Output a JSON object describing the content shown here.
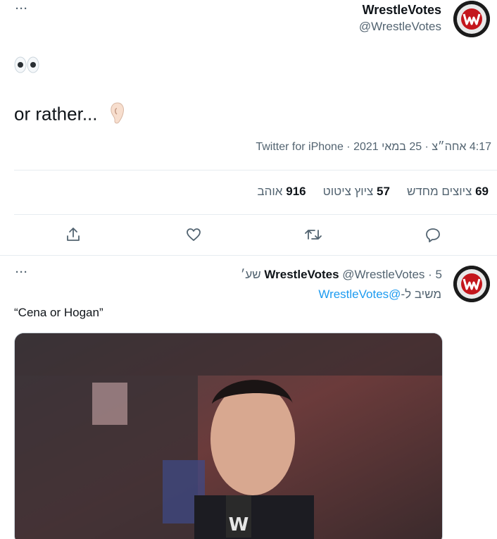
{
  "tweet1": {
    "more": "···",
    "display_name": "WrestleVotes",
    "handle": "@WrestleVotes",
    "emoji_line": "👀",
    "body_text": "or rather...",
    "ear_icon": "ear-icon",
    "timestamp": "4:17 אחה״צ · 25 במאי 2021 · Twitter for iPhone",
    "stats": {
      "retweets_count": "69",
      "retweets_label": "ציוצים מחדש",
      "quotes_count": "57",
      "quotes_label": "ציוץ ציטוט",
      "likes_count": "916",
      "likes_label": "אוהב"
    },
    "actions": [
      "share-icon",
      "like-icon",
      "retweet-icon",
      "reply-icon"
    ],
    "avatar_text": "WRESTLEVOTES · EST. 2016"
  },
  "tweet2": {
    "more": "···",
    "display_name": "WrestleVotes",
    "handle": "@WrestleVotes",
    "time_ago": "5 שע׳",
    "reply_label": "משיב ל-",
    "reply_handle": "@WrestleVotes",
    "body_text": "“Cena or Hogan”",
    "media_icon": "gif-video"
  },
  "colors": {
    "text": "#0f1419",
    "secondary": "#536471",
    "link": "#1d9bf0",
    "divider": "#e6ecf0"
  }
}
